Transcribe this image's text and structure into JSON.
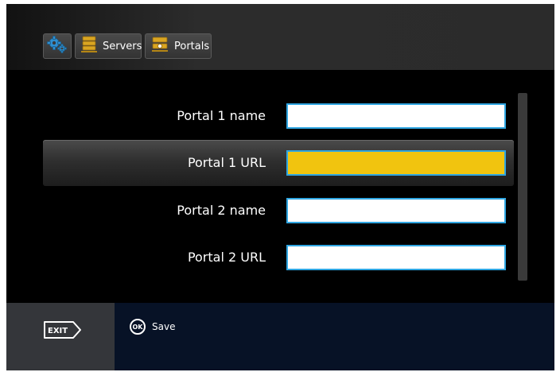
{
  "breadcrumb": {
    "settings_icon": "gears-icon",
    "servers_label": "Servers",
    "servers_icon": "server-icon",
    "portals_label": "Portals",
    "portals_icon": "portal-server-icon"
  },
  "form": {
    "rows": [
      {
        "label": "Portal 1 name",
        "value": "",
        "selected": false
      },
      {
        "label": "Portal 1 URL",
        "value": "",
        "selected": true
      },
      {
        "label": "Portal 2 name",
        "value": "",
        "selected": false
      },
      {
        "label": "Portal 2 URL",
        "value": "",
        "selected": false
      }
    ]
  },
  "footer": {
    "exit_label": "EXIT",
    "ok_label": "OK",
    "save_label": "Save"
  },
  "colors": {
    "selected_field": "#f1c40f",
    "field_border": "#2fa6e2",
    "icon_gold": "#d9a521"
  }
}
